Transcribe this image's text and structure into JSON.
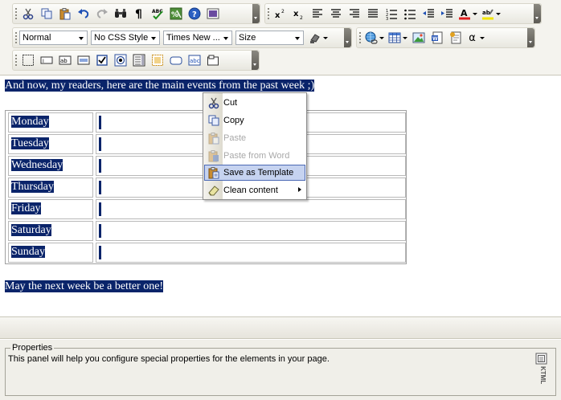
{
  "toolbar": {
    "paragraph_style": "Normal",
    "css_style": "No CSS Style",
    "font_family": "Times New ...",
    "font_size": "Size",
    "special_char": "α",
    "buttons": {
      "cut": "cut-icon",
      "copy": "copy-icon",
      "paste": "paste-icon",
      "undo": "undo-icon",
      "redo": "redo-icon",
      "find": "find-icon",
      "show_paragraphs": "pilcrow-icon",
      "spell_check": "spellcheck-icon",
      "clean_html": "clean-html-icon",
      "help": "help-icon",
      "source": "source-icon",
      "superscript": "superscript-icon",
      "subscript": "subscript-icon"
    }
  },
  "editor": {
    "intro_text": "And now, my readers, here are the main events from the past week ;)",
    "outro_text": "May the next week be a better one!",
    "days": [
      "Monday",
      "Tuesday",
      "Wednesday",
      "Thursday",
      "Friday",
      "Saturday",
      "Sunday"
    ],
    "selection_color": "#0a246a"
  },
  "context_menu": {
    "items": [
      {
        "label": "Cut",
        "enabled": true
      },
      {
        "label": "Copy",
        "enabled": true
      },
      {
        "label": "Paste",
        "enabled": false
      },
      {
        "label": "Paste from Word",
        "enabled": false
      },
      {
        "label": "Save as Template",
        "enabled": true,
        "highlighted": true
      },
      {
        "label": "Clean content",
        "enabled": true,
        "has_submenu": true
      }
    ]
  },
  "properties": {
    "legend": "Properties",
    "description": "This panel will help you configure special properties for the elements in your page.",
    "logo_text": "KTML"
  }
}
